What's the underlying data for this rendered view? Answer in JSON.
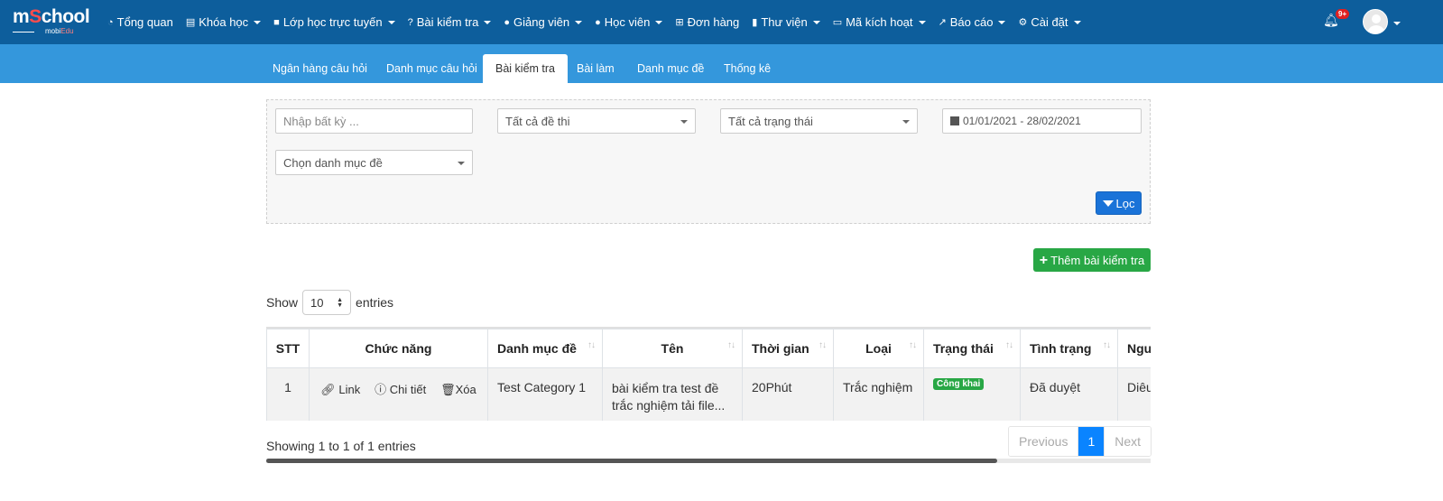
{
  "logo": {
    "name_prefix": "m",
    "name_s": "S",
    "name_rest": "chool",
    "sub_prefix": "mobi",
    "sub_suffix": "Edu"
  },
  "nav": {
    "items": [
      {
        "icon": "dashboard-icon",
        "glyph": "◔",
        "label": "Tổng quan",
        "caret": false
      },
      {
        "icon": "list-icon",
        "glyph": "▤",
        "label": "Khóa học",
        "caret": true
      },
      {
        "icon": "video-icon",
        "glyph": "■",
        "label": "Lớp học trực tuyến",
        "caret": true
      },
      {
        "icon": "question-icon",
        "glyph": "?",
        "label": "Bài kiểm tra",
        "caret": true
      },
      {
        "icon": "users-icon",
        "glyph": "●",
        "label": "Giảng viên",
        "caret": true
      },
      {
        "icon": "user-icon",
        "glyph": "●",
        "label": "Học viên",
        "caret": true
      },
      {
        "icon": "cart-icon",
        "glyph": "⊞",
        "label": "Đơn hàng",
        "caret": false
      },
      {
        "icon": "book-icon",
        "glyph": "▮",
        "label": "Thư viện",
        "caret": true
      },
      {
        "icon": "card-icon",
        "glyph": "▭",
        "label": "Mã kích hoạt",
        "caret": true
      },
      {
        "icon": "chart-icon",
        "glyph": "↗",
        "label": "Báo cáo",
        "caret": true
      },
      {
        "icon": "gears-icon",
        "glyph": "⚙",
        "label": "Cài đặt",
        "caret": true
      }
    ],
    "notification_count": "9+"
  },
  "tabs": [
    {
      "label": "Ngân hàng câu hỏi",
      "active": false
    },
    {
      "label": "Danh mục câu hỏi",
      "active": false
    },
    {
      "label": "Bài kiểm tra",
      "active": true
    },
    {
      "label": "Bài làm",
      "active": false
    },
    {
      "label": "Danh mục đề",
      "active": false
    },
    {
      "label": "Thống kê",
      "active": false
    }
  ],
  "filter": {
    "search_placeholder": "Nhập bất kỳ ...",
    "exam_select": "Tất cả đề thi",
    "status_select": "Tất cả trạng thái",
    "date_range": "01/01/2021 - 28/02/2021",
    "category_select": "Chọn danh mục đề",
    "filter_button": "Lọc"
  },
  "add_button": "Thêm bài kiểm tra",
  "length": {
    "show": "Show",
    "value": "10",
    "entries": "entries"
  },
  "table": {
    "headers": [
      "STT",
      "Chức năng",
      "Danh mục đề",
      "Tên",
      "Thời gian",
      "Loại",
      "Trạng thái",
      "Tình trạng",
      "Ngư"
    ],
    "rows": [
      {
        "stt": "1",
        "actions": {
          "link": "Link",
          "detail": "Chi tiết",
          "delete": "Xóa"
        },
        "category": "Test Category 1",
        "name_line1": "bài kiểm tra test đề",
        "name_line2": "trắc nghiệm tải file...",
        "time": "20Phút",
        "type": "Trắc nghiệm",
        "status": "Công khai",
        "condition": "Đã duyệt",
        "creator": "Diêu"
      }
    ]
  },
  "footer": {
    "info": "Showing 1 to 1 of 1 entries",
    "previous": "Previous",
    "page": "1",
    "next": "Next"
  },
  "colors": {
    "topbar": "#0d5e9c",
    "subbar": "#3497dc",
    "primary": "#1a73d8",
    "success": "#28a745",
    "page_active": "#0a84ff"
  }
}
